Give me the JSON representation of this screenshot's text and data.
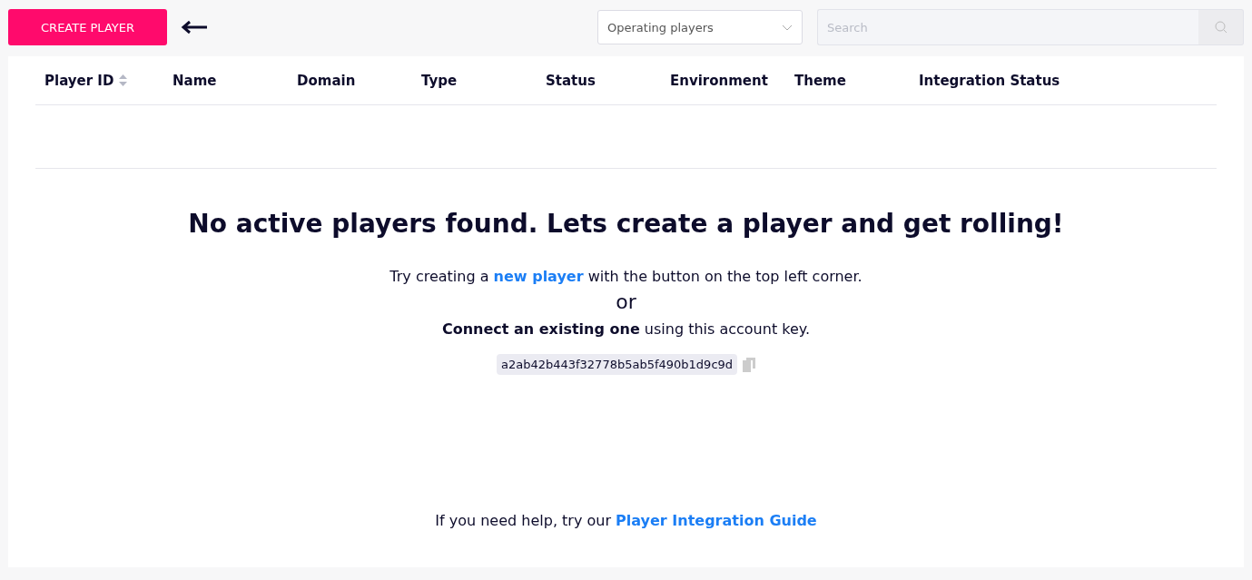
{
  "toolbar": {
    "create_button": "CREATE PLAYER",
    "filter": {
      "value": "Operating players"
    },
    "search": {
      "placeholder": "Search"
    }
  },
  "table": {
    "columns": [
      {
        "label": "Player ID",
        "sortable": true
      },
      {
        "label": "Name",
        "sortable": false
      },
      {
        "label": "Domain",
        "sortable": false
      },
      {
        "label": "Type",
        "sortable": false
      },
      {
        "label": "Status",
        "sortable": false
      },
      {
        "label": "Environment",
        "sortable": false
      },
      {
        "label": "Theme",
        "sortable": false
      },
      {
        "label": "Integration Status",
        "sortable": false
      }
    ]
  },
  "empty_state": {
    "heading": "No active players found. Lets create a player and get rolling!",
    "hint": {
      "before": "Try creating a",
      "link": "new player",
      "after": "with the button on the top left corner."
    },
    "or": "or",
    "connect": "**Connect an existing one** using this account key.",
    "account_key": "a2ab42b443f32778b5ab5f490b1d9c9d",
    "help": {
      "before": "If you need help, try our",
      "link": "Player Integration Guide"
    }
  }
}
